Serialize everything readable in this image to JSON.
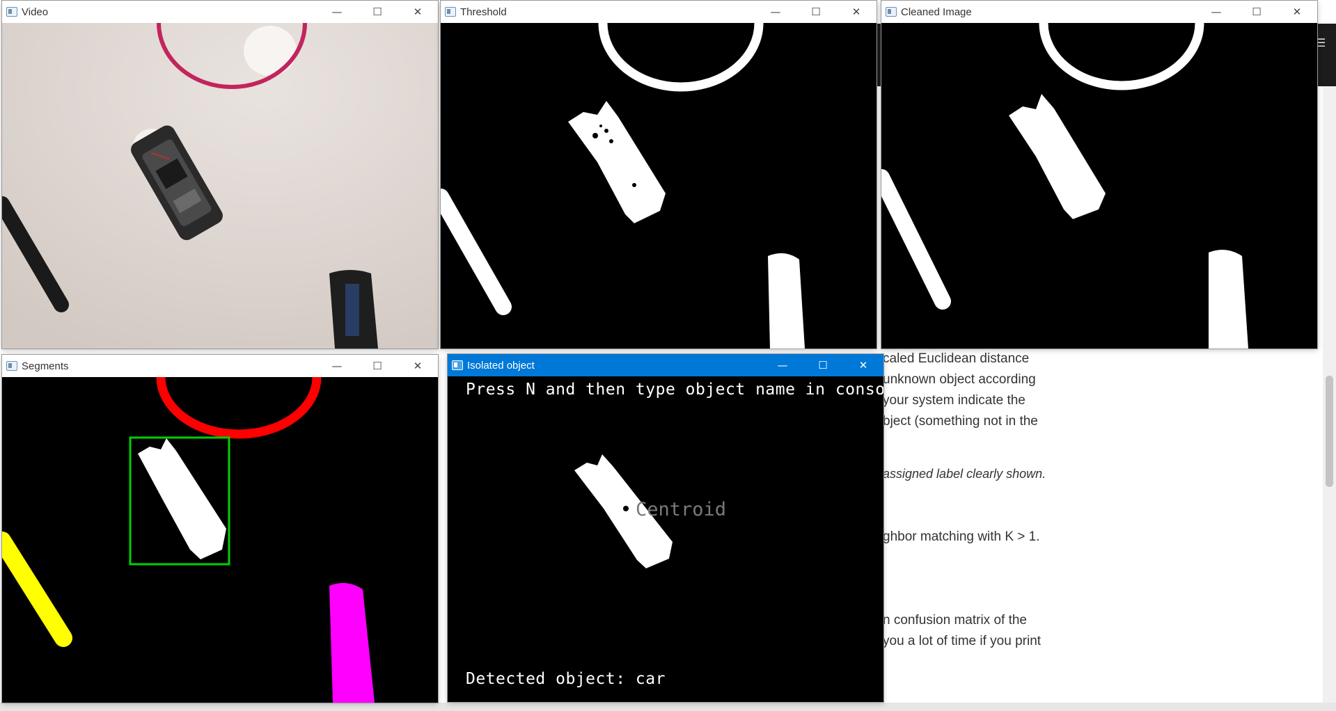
{
  "windows": {
    "video": {
      "title": "Video"
    },
    "threshold": {
      "title": "Threshold"
    },
    "cleaned": {
      "title": "Cleaned Image"
    },
    "segments": {
      "title": "Segments"
    },
    "isolated": {
      "title": "Isolated object",
      "instruction": "Press N and then type object name in console",
      "centroid_label": "Centroid",
      "detected": "Detected object: car"
    }
  },
  "titlebar_icons": [
    "minimize-icon",
    "maximize-icon",
    "close-icon"
  ],
  "background_doc": {
    "lines": [
      "caled Euclidean distance",
      "unknown object according",
      "your system indicate the",
      "bject (something not in the",
      "assigned label clearly shown.",
      "ghbor matching with K > 1.",
      "n confusion matrix of the",
      "you a lot of time if you print"
    ]
  },
  "colors": {
    "active_titlebar": "#0078d7",
    "segment_red": "#ff0000",
    "segment_yellow": "#ffff00",
    "segment_magenta": "#ff00ff",
    "bbox_green": "#00d000"
  }
}
